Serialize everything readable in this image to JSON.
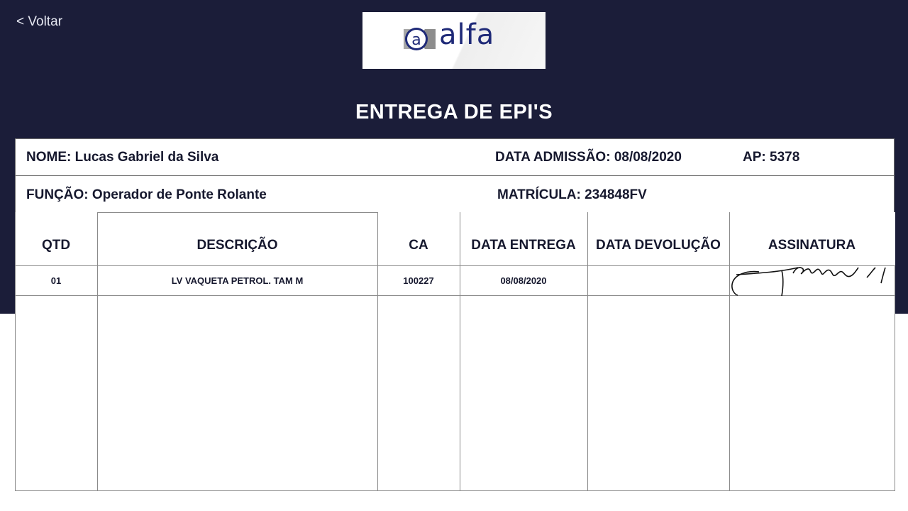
{
  "nav": {
    "back_label": "< Voltar"
  },
  "logo": {
    "text": "alfa",
    "mark": "a"
  },
  "page": {
    "title": "ENTREGA DE EPI'S"
  },
  "employee": {
    "name": "NOME: Lucas Gabriel da Silva",
    "admission": "DATA ADMISSÃO: 08/08/2020",
    "ap": "AP: 5378",
    "role": "FUNÇÃO: Operador de Ponte Rolante",
    "registration": "MATRÍCULA: 234848FV"
  },
  "table": {
    "headers": [
      "QTD",
      "DESCRIÇÃO",
      "CA",
      "DATA ENTREGA",
      "DATA DEVOLUÇÃO",
      "ASSINATURA"
    ],
    "rows": [
      {
        "qtd": "01",
        "descricao": "LV VAQUETA PETROL. TAM M",
        "ca": "100227",
        "data_entrega": "08/08/2020",
        "data_devolucao": ""
      }
    ]
  },
  "colors": {
    "background": "#1b1d39",
    "text_dark": "#16182e",
    "logo_blue": "#1f2a78"
  }
}
